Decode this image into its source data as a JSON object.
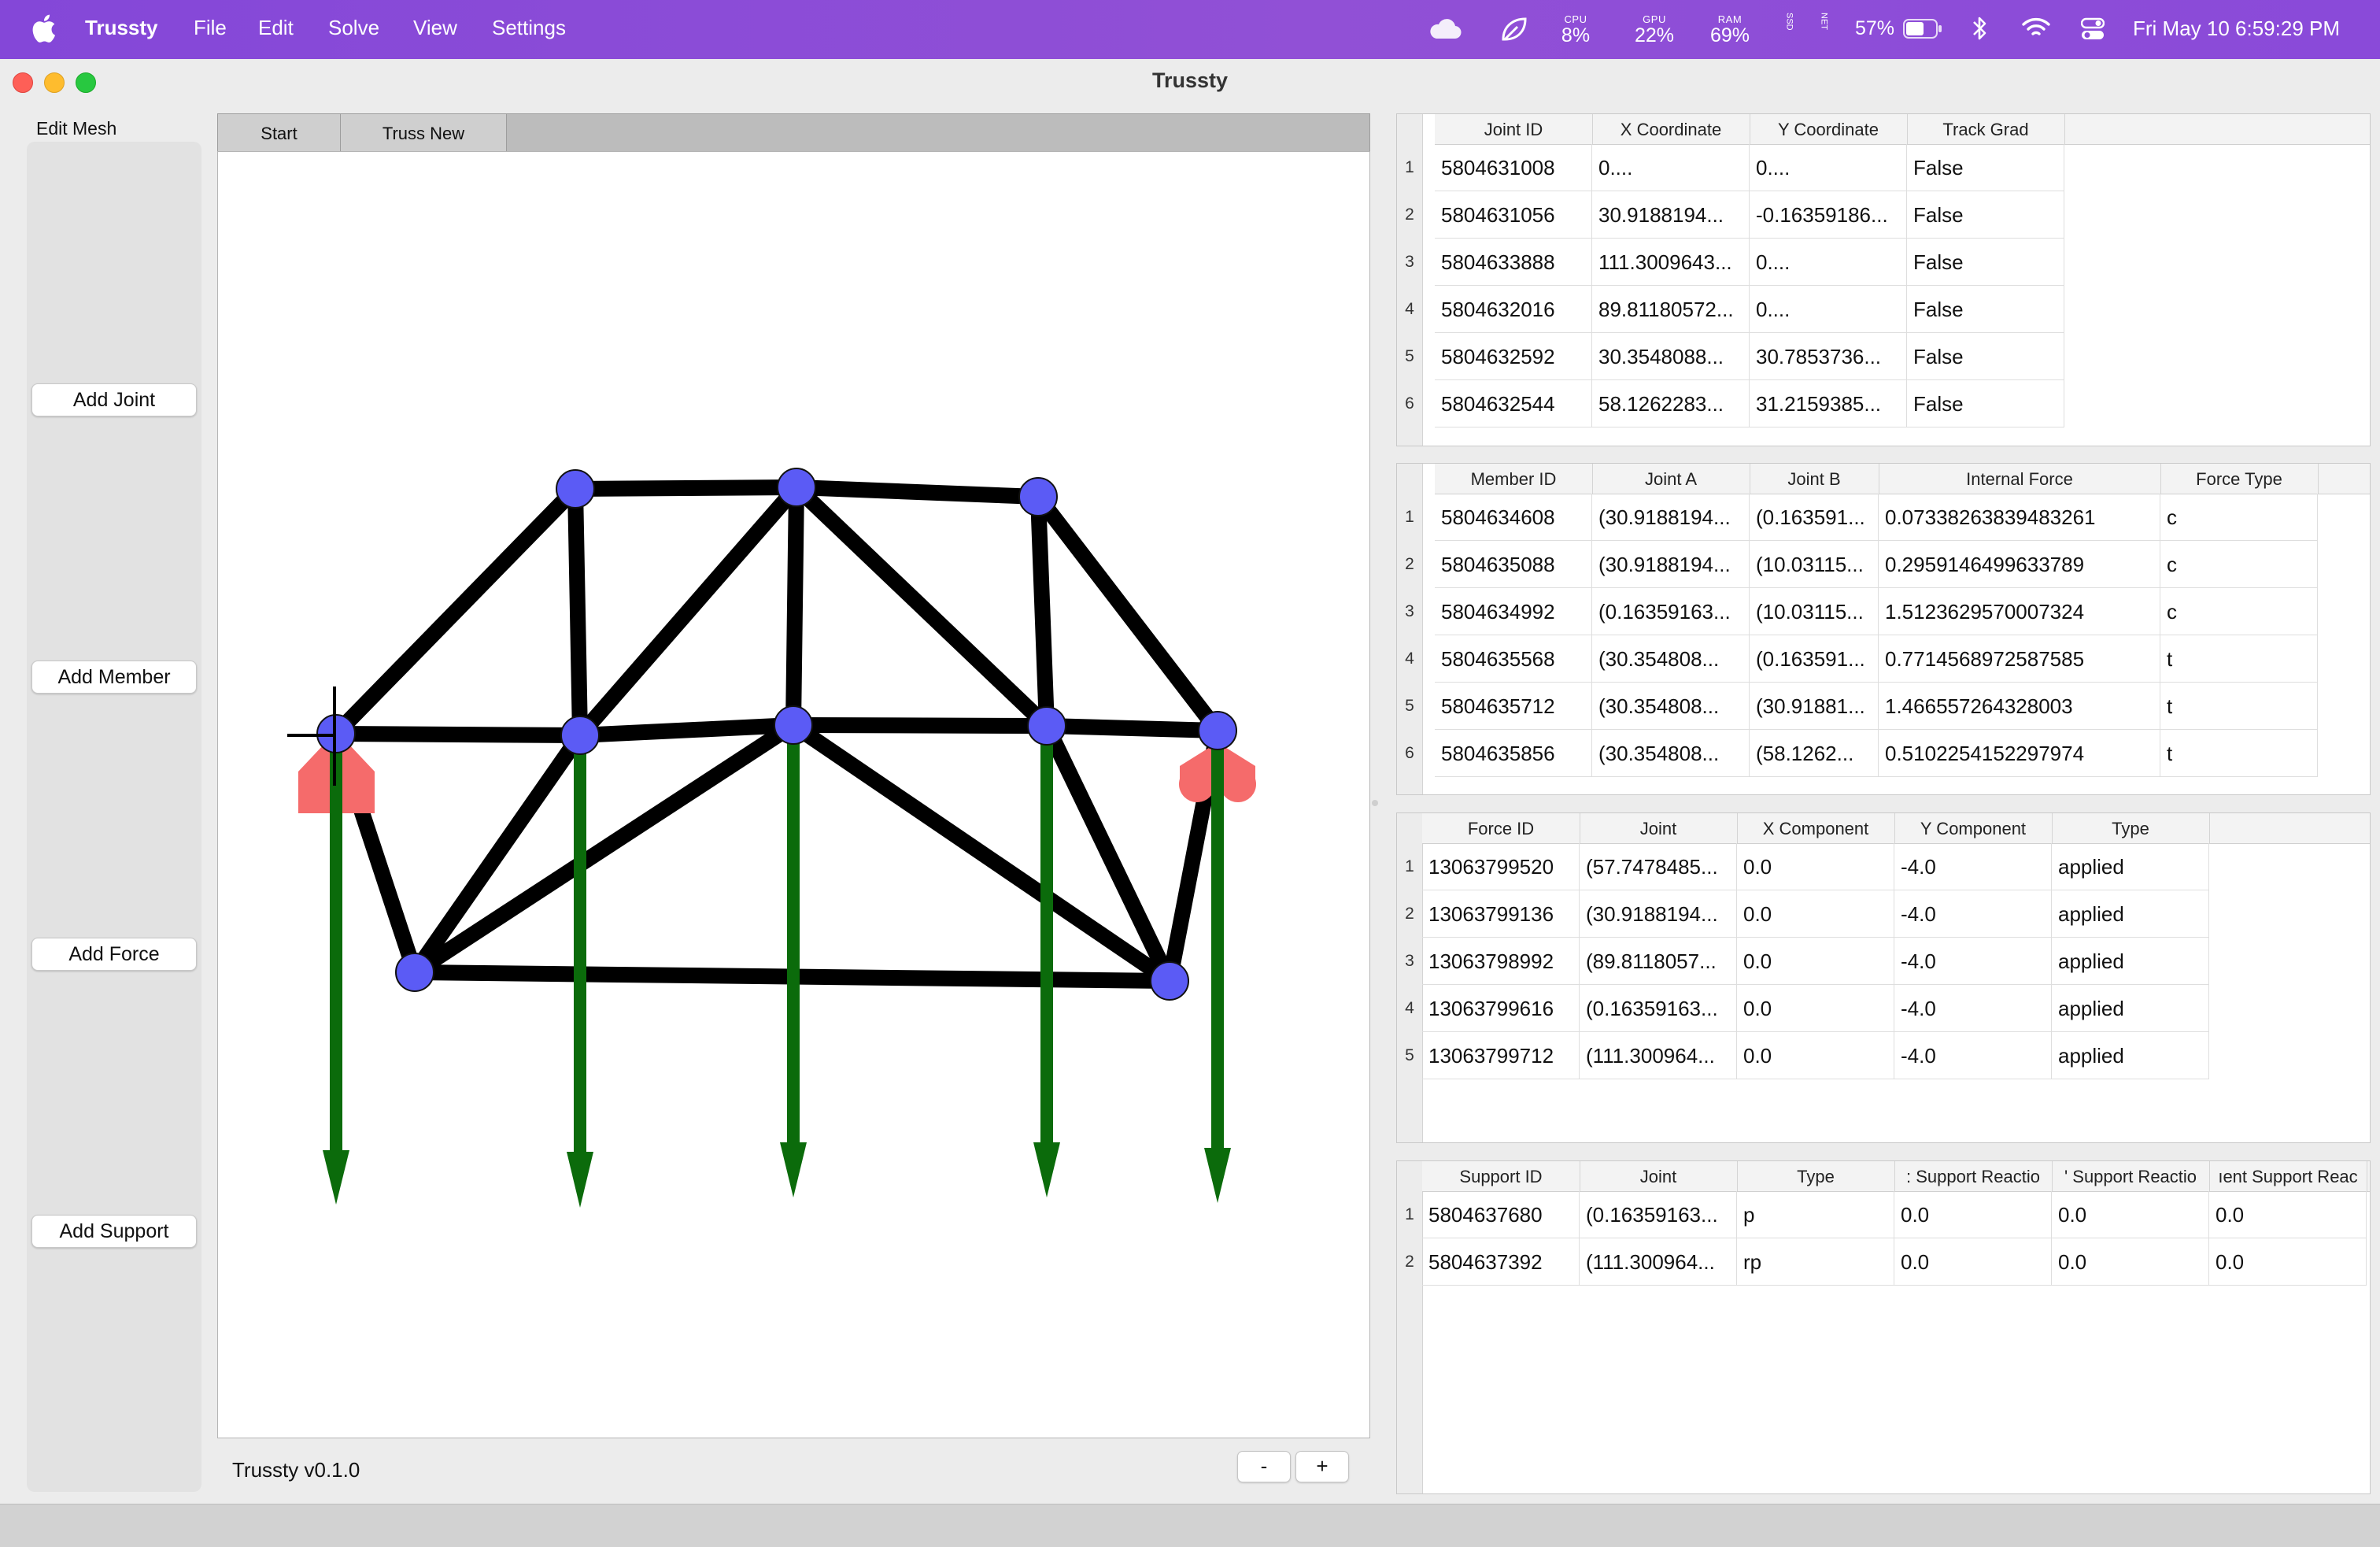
{
  "menubar": {
    "app_name": "Trussty",
    "menus": [
      "File",
      "Edit",
      "Solve",
      "View",
      "Settings"
    ],
    "cpu_label": "CPU",
    "cpu_value": "8%",
    "gpu_label": "GPU",
    "gpu_value": "22%",
    "ram_label": "RAM",
    "ram_value": "69%",
    "ssd_label": "SSD",
    "net_label": "NET",
    "battery": "57%",
    "datetime": "Fri May 10  6:59:29 PM"
  },
  "window": {
    "title": "Trussty"
  },
  "sidebar": {
    "label": "Edit Mesh",
    "buttons": [
      "Add Joint",
      "Add Member",
      "Add Force",
      "Add Support"
    ]
  },
  "tabs": [
    "Start",
    "Truss New"
  ],
  "footer": {
    "version": "Trussty v0.1.0",
    "zoom_out": "-",
    "zoom_in": "+"
  },
  "colors": {
    "menubar": "#8a4bd6",
    "joint": "#5b5bf5",
    "member": "#000000",
    "force": "#0b6b0b",
    "support": "#f56b6b"
  },
  "joints_table": {
    "headers": [
      "Joint ID",
      "X Coordinate",
      "Y Coordinate",
      "Track Grad"
    ],
    "rows": [
      [
        "5804631008",
        "0....",
        "0....",
        "False"
      ],
      [
        "5804631056",
        "30.9188194...",
        "-0.16359186...",
        "False"
      ],
      [
        "5804633888",
        "111.3009643...",
        "0....",
        "False"
      ],
      [
        "5804632016",
        "89.81180572...",
        "0....",
        "False"
      ],
      [
        "5804632592",
        "30.3548088...",
        "30.7853736...",
        "False"
      ],
      [
        "5804632544",
        "58.1262283...",
        "31.2159385...",
        "False"
      ]
    ]
  },
  "members_table": {
    "headers": [
      "Member ID",
      "Joint A",
      "Joint B",
      "Internal Force",
      "Force Type"
    ],
    "rows": [
      [
        "5804634608",
        "(30.9188194...",
        "(0.163591...",
        "0.07338263839483261",
        "c"
      ],
      [
        "5804635088",
        "(30.9188194...",
        "(10.03115...",
        "0.2959146499633789",
        "c"
      ],
      [
        "5804634992",
        "(0.16359163...",
        "(10.03115...",
        "1.5123629570007324",
        "c"
      ],
      [
        "5804635568",
        "(30.354808...",
        "(0.163591...",
        "0.7714568972587585",
        "t"
      ],
      [
        "5804635712",
        "(30.354808...",
        "(30.91881...",
        "1.466557264328003",
        "t"
      ],
      [
        "5804635856",
        "(30.354808...",
        "(58.1262...",
        "0.5102254152297974",
        "t"
      ]
    ]
  },
  "forces_table": {
    "headers": [
      "Force ID",
      "Joint",
      "X Component",
      "Y Component",
      "Type"
    ],
    "rows": [
      [
        "13063799520",
        "(57.7478485...",
        "0.0",
        "-4.0",
        "applied"
      ],
      [
        "13063799136",
        "(30.9188194...",
        "0.0",
        "-4.0",
        "applied"
      ],
      [
        "13063798992",
        "(89.8118057...",
        "0.0",
        "-4.0",
        "applied"
      ],
      [
        "13063799616",
        "(0.16359163...",
        "0.0",
        "-4.0",
        "applied"
      ],
      [
        "13063799712",
        "(111.300964...",
        "0.0",
        "-4.0",
        "applied"
      ]
    ]
  },
  "supports_table": {
    "headers": [
      "Support ID",
      "Joint",
      "Type",
      ": Support Reactio",
      "' Support Reactio",
      "ıent Support Reac"
    ],
    "rows": [
      [
        "5804637680",
        "(0.16359163...",
        "p",
        "0.0",
        "0.0",
        "0.0"
      ],
      [
        "5804637392",
        "(111.300964...",
        "rp",
        "0.0",
        "0.0",
        "0.0"
      ]
    ]
  }
}
